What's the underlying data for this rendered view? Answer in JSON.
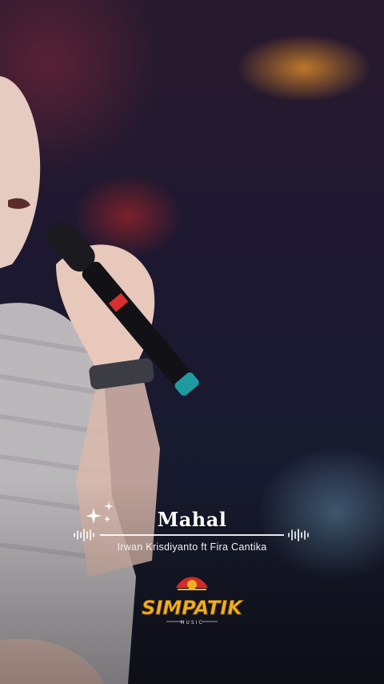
{
  "song": {
    "title": "Mahal",
    "artist": "Irwan Krisdiyanto ft Fira Cantika"
  },
  "logo": {
    "name": "SIMPATIK",
    "tagline": "MUSIC"
  },
  "colors": {
    "logo_gold": "#f2b01e",
    "logo_red": "#d42a2a",
    "text": "#ffffff"
  },
  "icons": [
    "sparkle-icon",
    "soundwave-icon",
    "simpatik-music-logo"
  ]
}
